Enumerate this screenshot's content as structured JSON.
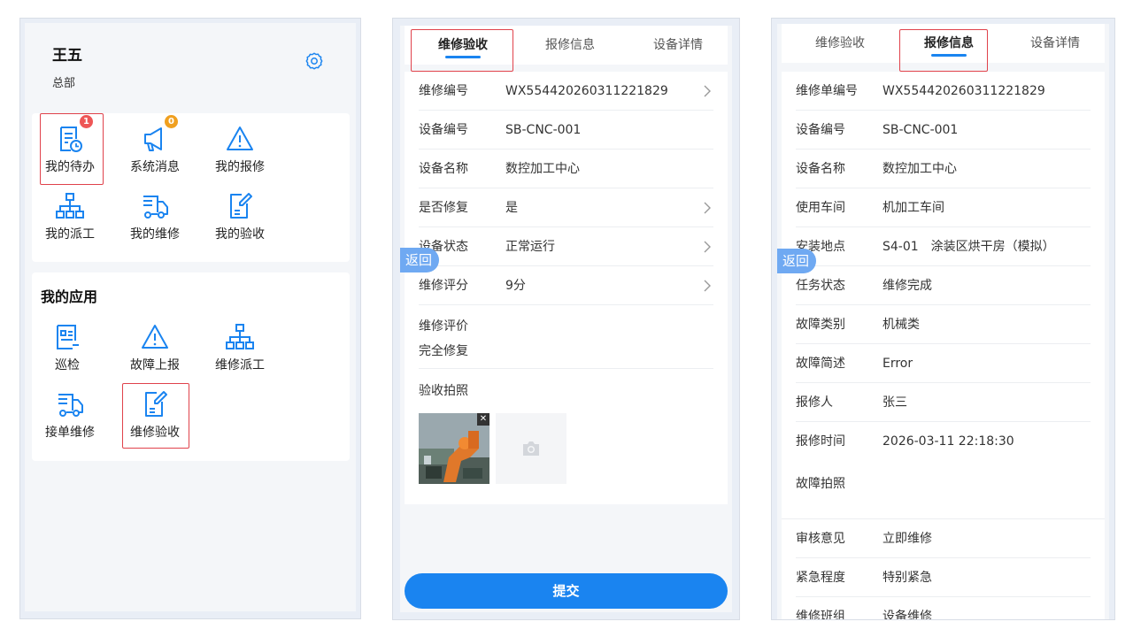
{
  "home": {
    "user_name": "王五",
    "org": "总部",
    "settings_icon": "gear-icon",
    "shortcuts": [
      {
        "label": "我的待办",
        "icon": "todo-clock-icon",
        "badge": "1",
        "badge_color": "#ee5656"
      },
      {
        "label": "系统消息",
        "icon": "megaphone-icon",
        "badge": "0",
        "badge_color": "#f0a020"
      },
      {
        "label": "我的报修",
        "icon": "warning-icon"
      },
      {
        "label": "我的派工",
        "icon": "org-tree-icon"
      },
      {
        "label": "我的维修",
        "icon": "truck-icon"
      },
      {
        "label": "我的验收",
        "icon": "edit-doc-icon"
      }
    ],
    "apps_title": "我的应用",
    "apps": [
      {
        "label": "巡检",
        "icon": "inspection-icon"
      },
      {
        "label": "故障上报",
        "icon": "warning-icon"
      },
      {
        "label": "维修派工",
        "icon": "org-tree-icon"
      },
      {
        "label": "接单维修",
        "icon": "truck-icon"
      },
      {
        "label": "维修验收",
        "icon": "edit-doc-icon"
      }
    ]
  },
  "acceptance": {
    "tabs": [
      "维修验收",
      "报修信息",
      "设备详情"
    ],
    "active_tab": 0,
    "back_label": "返回",
    "rows": [
      {
        "key": "维修编号",
        "value": "WX554420260311221829",
        "chevron": true
      },
      {
        "key": "设备编号",
        "value": "SB-CNC-001",
        "chevron": false
      },
      {
        "key": "设备名称",
        "value": "数控加工中心",
        "chevron": false
      },
      {
        "key": "是否修复",
        "value": "是",
        "chevron": true
      },
      {
        "key": "设备状态",
        "value": "正常运行",
        "chevron": true
      },
      {
        "key": "维修评分",
        "value": "9分",
        "chevron": true
      }
    ],
    "evaluation_label": "维修评价",
    "evaluation_value": "完全修复",
    "photo_label": "验收拍照",
    "submit_label": "提交"
  },
  "repair_info": {
    "tabs": [
      "维修验收",
      "报修信息",
      "设备详情"
    ],
    "active_tab": 1,
    "back_label": "返回",
    "rows": [
      {
        "key": "维修单编号",
        "value": "WX554420260311221829"
      },
      {
        "key": "设备编号",
        "value": "SB-CNC-001"
      },
      {
        "key": "设备名称",
        "value": "数控加工中心"
      },
      {
        "key": "使用车间",
        "value": "机加工车间"
      },
      {
        "key": "安装地点",
        "value": "S4-01　涂装区烘干房（模拟）"
      },
      {
        "key": "任务状态",
        "value": "维修完成"
      },
      {
        "key": "故障类别",
        "value": "机械类"
      },
      {
        "key": "故障简述",
        "value": "Error"
      },
      {
        "key": "报修人",
        "value": "张三"
      },
      {
        "key": "报修时间",
        "value": "2026-03-11 22:18:30"
      }
    ],
    "photo_label": "故障拍照",
    "rows2": [
      {
        "key": "审核意见",
        "value": "立即维修"
      },
      {
        "key": "紧急程度",
        "value": "特别紧急"
      },
      {
        "key": "维修班组",
        "value": "设备维修"
      }
    ]
  },
  "colors": {
    "accent": "#1a84f0",
    "highlight": "#e0424b"
  }
}
